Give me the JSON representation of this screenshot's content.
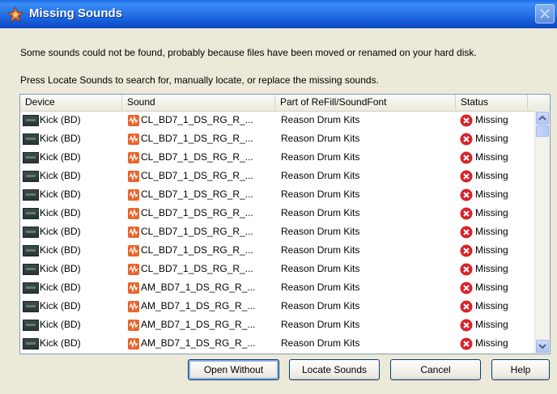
{
  "window": {
    "title": "Missing Sounds"
  },
  "messages": {
    "line1": "Some sounds could not be found, probably because files have been moved or renamed on your hard disk.",
    "line2": "Press Locate Sounds to search for, manually locate, or replace the missing sounds."
  },
  "table": {
    "columns": [
      "Device",
      "Sound",
      "Part of ReFill/SoundFont",
      "Status"
    ],
    "rows": [
      {
        "device": "Kick (BD)",
        "sound": "CL_BD7_1_DS_RG_R_...",
        "part": "Reason Drum Kits",
        "status": "Missing"
      },
      {
        "device": "Kick (BD)",
        "sound": "CL_BD7_1_DS_RG_R_...",
        "part": "Reason Drum Kits",
        "status": "Missing"
      },
      {
        "device": "Kick (BD)",
        "sound": "CL_BD7_1_DS_RG_R_...",
        "part": "Reason Drum Kits",
        "status": "Missing"
      },
      {
        "device": "Kick (BD)",
        "sound": "CL_BD7_1_DS_RG_R_...",
        "part": "Reason Drum Kits",
        "status": "Missing"
      },
      {
        "device": "Kick (BD)",
        "sound": "CL_BD7_1_DS_RG_R_...",
        "part": "Reason Drum Kits",
        "status": "Missing"
      },
      {
        "device": "Kick (BD)",
        "sound": "CL_BD7_1_DS_RG_R_...",
        "part": "Reason Drum Kits",
        "status": "Missing"
      },
      {
        "device": "Kick (BD)",
        "sound": "CL_BD7_1_DS_RG_R_...",
        "part": "Reason Drum Kits",
        "status": "Missing"
      },
      {
        "device": "Kick (BD)",
        "sound": "CL_BD7_1_DS_RG_R_...",
        "part": "Reason Drum Kits",
        "status": "Missing"
      },
      {
        "device": "Kick (BD)",
        "sound": "CL_BD7_1_DS_RG_R_...",
        "part": "Reason Drum Kits",
        "status": "Missing"
      },
      {
        "device": "Kick (BD)",
        "sound": "AM_BD7_1_DS_RG_R_...",
        "part": "Reason Drum Kits",
        "status": "Missing"
      },
      {
        "device": "Kick (BD)",
        "sound": "AM_BD7_1_DS_RG_R_...",
        "part": "Reason Drum Kits",
        "status": "Missing"
      },
      {
        "device": "Kick (BD)",
        "sound": "AM_BD7_1_DS_RG_R_...",
        "part": "Reason Drum Kits",
        "status": "Missing"
      },
      {
        "device": "Kick (BD)",
        "sound": "AM_BD7_1_DS_RG_R_...",
        "part": "Reason Drum Kits",
        "status": "Missing"
      }
    ]
  },
  "buttons": {
    "open_without": "Open Without",
    "locate_sounds": "Locate Sounds",
    "cancel": "Cancel",
    "help": "Help"
  },
  "icons": {
    "title": "reason-logo-icon",
    "device": "device-rack-icon",
    "sound": "wav-file-icon",
    "status": "error-x-icon"
  },
  "colors": {
    "titlebar": "#0d49c2",
    "error": "#d8232a",
    "window_bg": "#ece9d8"
  }
}
